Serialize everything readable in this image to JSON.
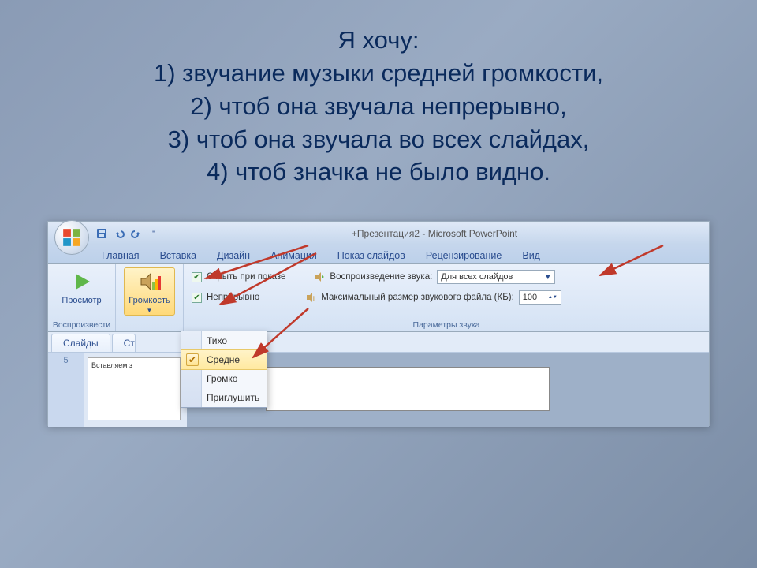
{
  "title": {
    "heading": "Я хочу",
    "colon": ":",
    "line1_pre": "1) звучание музыки средней громкости",
    "line2_pre": "2) чтоб она звучала непрерывно",
    "line3_pre": "3) чтоб она звучала во всех слайдах",
    "line4_pre": "4) чтоб значка не было видно",
    "comma": ",",
    "dot": "."
  },
  "window": {
    "doc_title": "+Презентация2 - Microsoft PowerPoint"
  },
  "tabs": [
    "Главная",
    "Вставка",
    "Дизайн",
    "Анимация",
    "Показ слайдов",
    "Рецензирование",
    "Вид"
  ],
  "ribbon": {
    "preview_label": "Просмотр",
    "preview_group": "Воспроизвести",
    "volume_label": "Громкость",
    "hide_label": "Скрыть при показе",
    "loop_label": "Непрерывно",
    "playback_label": "Воспроизведение звука:",
    "playback_value": "Для всех слайдов",
    "maxsize_label": "Максимальный размер звукового файла (КБ):",
    "maxsize_value": "100",
    "params_group": "Параметры звука"
  },
  "volume_menu": {
    "items": [
      "Тихо",
      "Средне",
      "Громко",
      "Приглушить"
    ],
    "selected_index": 1
  },
  "subtabs": {
    "slides": "Слайды",
    "structure": "Стр"
  },
  "thumb": {
    "num": "5",
    "caption": "Вставляем з"
  }
}
